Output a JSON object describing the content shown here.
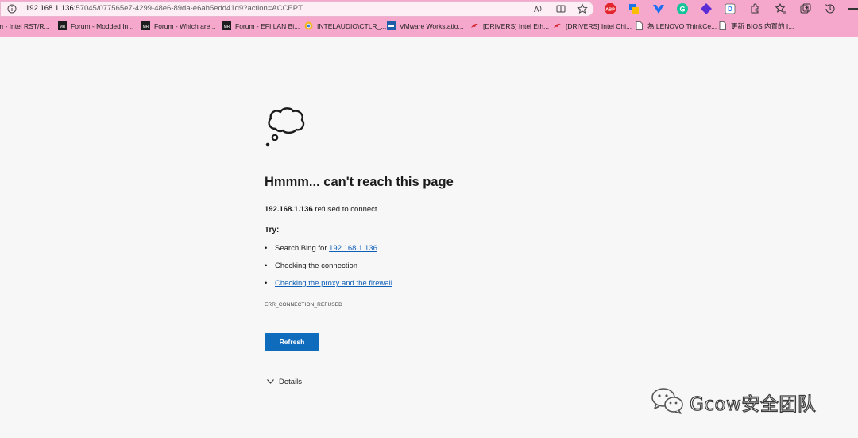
{
  "address_bar": {
    "url_host": "192.168.1.136",
    "url_rest": ":57045/077565e7-4299-48e6-89da-e6ab5edd41d9?action=ACCEPT"
  },
  "bookmarks": [
    {
      "label": "m - Intel RST/R...",
      "icon": "none"
    },
    {
      "label": "Forum - Modded In...",
      "icon": "forum-icon"
    },
    {
      "label": "Forum - Which are...",
      "icon": "forum-icon"
    },
    {
      "label": "Forum - EFI LAN Bi...",
      "icon": "forum-icon"
    },
    {
      "label": "INTELAUDIO\\CTLR_...",
      "icon": "chrome-icon"
    },
    {
      "label": "VMware Workstatio...",
      "icon": "vmware-icon"
    },
    {
      "label": "[DRIVERS] Intel Eth...",
      "icon": "rog-icon"
    },
    {
      "label": "[DRIVERS] Intel Chi...",
      "icon": "rog-icon"
    },
    {
      "label": "為 LENOVO ThinkCe...",
      "icon": "page-icon"
    },
    {
      "label": "更新 BIOS 内置的 I...",
      "icon": "page-icon"
    }
  ],
  "error_page": {
    "title": "Hmmm... can't reach this page",
    "host": "192.168.1.136",
    "refused_text": " refused to connect.",
    "try_label": "Try:",
    "suggestions": [
      {
        "prefix": "Search Bing for ",
        "link": "192 168 1 136"
      },
      {
        "prefix": "Checking the connection",
        "link": ""
      },
      {
        "prefix": "",
        "link": "Checking the proxy and the firewall"
      }
    ],
    "error_code": "ERR_CONNECTION_REFUSED",
    "refresh_label": "Refresh",
    "details_label": "Details"
  },
  "watermark": {
    "text": "Gcow安全团队"
  },
  "colors": {
    "chrome": "#f6a8cc",
    "accent": "#0f6cbd",
    "link": "#0f5fb8",
    "page_bg": "#f7f7f7"
  }
}
